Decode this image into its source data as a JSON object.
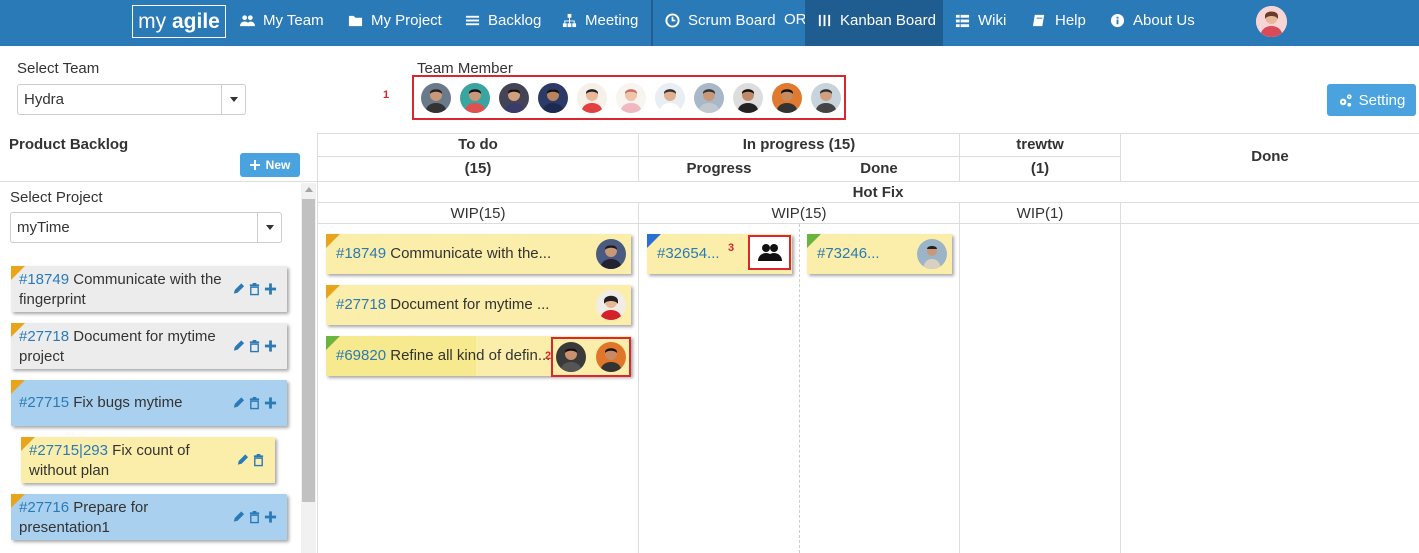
{
  "nav": {
    "brand_prefix": "my ",
    "brand_suffix": "agile",
    "items": [
      {
        "label": "My Team",
        "icon": "team-icon"
      },
      {
        "label": "My Project",
        "icon": "folder-icon"
      },
      {
        "label": "Backlog",
        "icon": "list-icon"
      },
      {
        "label": "Meeting",
        "icon": "sitemap-icon"
      },
      {
        "label": "Scrum Board",
        "icon": "clock-icon"
      },
      {
        "label": "Kanban Board",
        "icon": "columns-icon"
      },
      {
        "label": "Wiki",
        "icon": "grid-icon"
      },
      {
        "label": "Help",
        "icon": "book-icon"
      },
      {
        "label": "About Us",
        "icon": "info-icon"
      }
    ],
    "or_label": "OR",
    "active": "Kanban Board"
  },
  "team": {
    "label": "Select Team",
    "value": "Hydra",
    "member_label": "Team Member",
    "annotation": "1",
    "member_count": 11
  },
  "setting_label": "Setting",
  "backlog": {
    "title": "Product Backlog",
    "new_label": "New",
    "project_label": "Select Project",
    "project_value": "myTime",
    "items": [
      {
        "id": "#18749",
        "text": "Communicate with the fingerprint"
      },
      {
        "id": "#27718",
        "text": "Document for mytime project"
      },
      {
        "id": "#27715",
        "text": "Fix bugs mytime"
      },
      {
        "id": "#27715|293",
        "text": "Fix count of without plan"
      },
      {
        "id": "#27716",
        "text": "Prepare for presentation1"
      }
    ]
  },
  "board": {
    "columns": {
      "todo": {
        "name": "To do",
        "count": "(15)",
        "wip": "WIP(15)"
      },
      "inprogress": {
        "name": "In progress (15)",
        "sub_progress": "Progress",
        "sub_done": "Done",
        "wip": "WIP(15)"
      },
      "trewtw": {
        "name": "trewtw",
        "count": "(1)",
        "wip": "WIP(1)"
      },
      "done": {
        "name": "Done"
      }
    },
    "swimlane": "Hot Fix",
    "cards": [
      {
        "id": "#18749",
        "text": "Communicate with the..."
      },
      {
        "id": "#27718",
        "text": "Document for mytime ..."
      },
      {
        "id": "#69820",
        "text": "Refine all kind of defin..."
      },
      {
        "id": "#32654...",
        "text": ""
      },
      {
        "id": "#73246...",
        "text": ""
      }
    ],
    "annotations": [
      "2",
      "3"
    ]
  },
  "colors": {
    "nav_bg": "#2a7ab8",
    "nav_active": "#1f5c90",
    "accent": "#4aa3df",
    "card_yellow": "#fbeeaa",
    "card_blue": "#a9d1ef",
    "card_grey": "#ececec",
    "corner_orange": "#e8a51b",
    "corner_green": "#6db33f",
    "corner_blue": "#2b6fd6",
    "highlight_red": "#d9262f"
  }
}
